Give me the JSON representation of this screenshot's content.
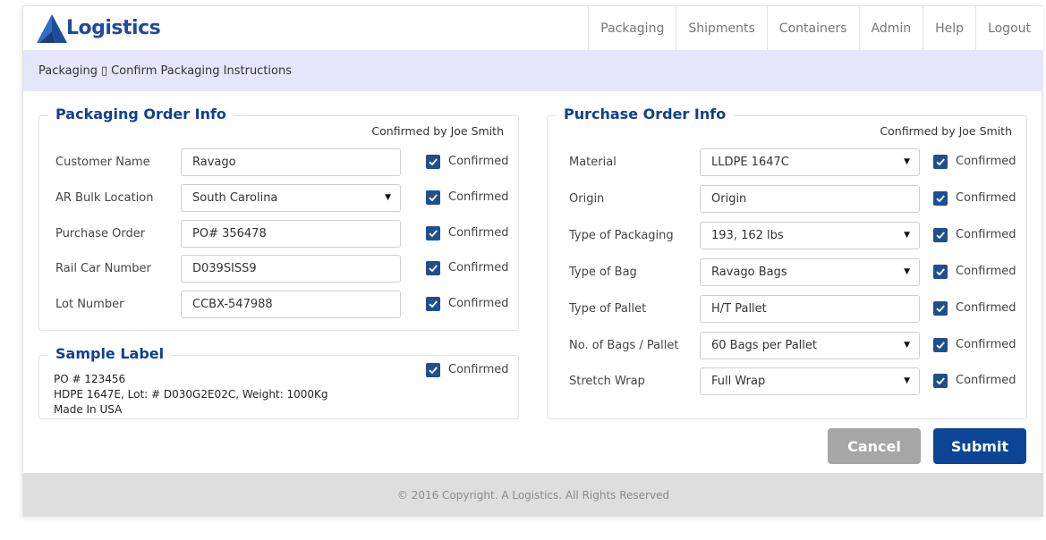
{
  "header": {
    "logo_text": "Logistics",
    "brand_color": "#1e4b9c",
    "nav": [
      {
        "label": "Packaging"
      },
      {
        "label": "Shipments"
      },
      {
        "label": "Containers"
      },
      {
        "label": "Admin"
      },
      {
        "label": "Help"
      },
      {
        "label": "Logout"
      }
    ]
  },
  "breadcrumb": {
    "root": "Packaging",
    "separator": "▯",
    "current": "Confirm Packaging Instructions"
  },
  "packaging_order": {
    "title": "Packaging Order Info",
    "confirmed_by": "Confirmed by Joe Smith",
    "rows": [
      {
        "label": "Customer Name",
        "value": "Ravago",
        "type": "text",
        "confirmed": "Confirmed"
      },
      {
        "label": "AR Bulk Location",
        "value": "South Carolina",
        "type": "select",
        "confirmed": "Confirmed"
      },
      {
        "label": "Purchase Order",
        "value": "PO# 356478",
        "type": "text",
        "confirmed": "Confirmed"
      },
      {
        "label": "Rail Car Number",
        "value": "D039SISS9",
        "type": "text",
        "confirmed": "Confirmed"
      },
      {
        "label": "Lot Number",
        "value": "CCBX-547988",
        "type": "text",
        "confirmed": "Confirmed"
      }
    ]
  },
  "sample_label": {
    "title": "Sample Label",
    "lines": [
      "PO # 123456",
      "HDPE 1647E, Lot: # D030G2E02C, Weight: 1000Kg",
      "Made In USA"
    ],
    "confirmed": "Confirmed"
  },
  "purchase_order": {
    "title": "Purchase Order Info",
    "confirmed_by": "Confirmed by Joe Smith",
    "rows": [
      {
        "label": "Material",
        "value": "LLDPE 1647C",
        "type": "select",
        "confirmed": "Confirmed"
      },
      {
        "label": "Origin",
        "value": "Origin",
        "type": "text",
        "confirmed": "Confirmed"
      },
      {
        "label": "Type of Packaging",
        "value": "193, 162 lbs",
        "type": "select",
        "confirmed": "Confirmed"
      },
      {
        "label": "Type of Bag",
        "value": "Ravago Bags",
        "type": "select",
        "confirmed": "Confirmed"
      },
      {
        "label": "Type of Pallet",
        "value": "H/T Pallet",
        "type": "text",
        "confirmed": "Confirmed"
      },
      {
        "label": "No. of Bags / Pallet",
        "value": "60 Bags per Pallet",
        "type": "select",
        "confirmed": "Confirmed"
      },
      {
        "label": "Stretch Wrap",
        "value": "Full Wrap",
        "type": "select",
        "confirmed": "Confirmed"
      }
    ]
  },
  "actions": {
    "cancel_label": "Cancel",
    "submit_label": "Submit"
  },
  "footer": {
    "copyright": "© 2016 Copyright. A Logistics. All Rights Reserved"
  },
  "icons": {
    "caret": "caret-down-icon",
    "check": "checkmark-icon"
  },
  "colors": {
    "breadcrumb_bg": "#e6e6fb",
    "checkbox": "#1e4f8f",
    "submit": "#0c4596",
    "cancel": "#a6a6a6"
  }
}
